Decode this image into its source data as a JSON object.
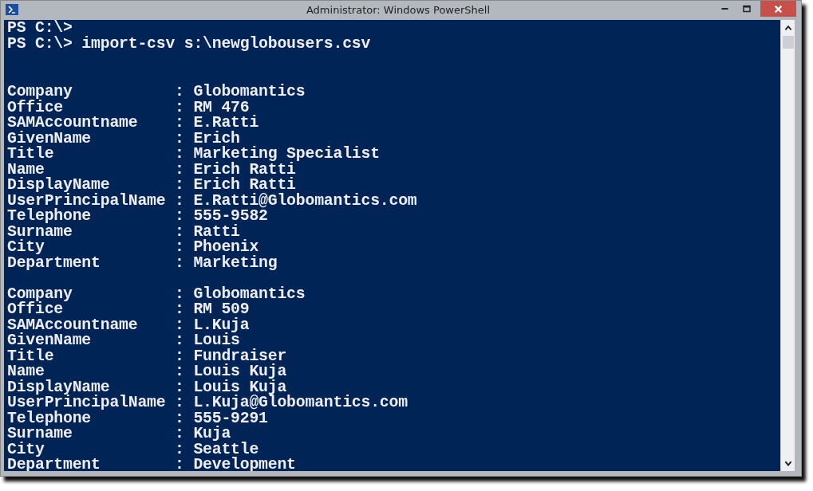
{
  "window": {
    "title": "Administrator: Windows PowerShell"
  },
  "console": {
    "command_lines": [
      "PS C:\\>",
      "PS C:\\> import-csv s:\\newglobousers.csv"
    ],
    "records": [
      {
        "lines": [
          "Company           : Globomantics",
          "Office            : RM 476",
          "SAMAccountname    : E.Ratti",
          "GivenName         : Erich",
          "Title             : Marketing Specialist",
          "Name              : Erich Ratti",
          "DisplayName       : Erich Ratti",
          "UserPrincipalName : E.Ratti@Globomantics.com",
          "Telephone         : 555-9582",
          "Surname           : Ratti",
          "City              : Phoenix",
          "Department        : Marketing"
        ]
      },
      {
        "lines": [
          "Company           : Globomantics",
          "Office            : RM 509",
          "SAMAccountname    : L.Kuja",
          "GivenName         : Louis",
          "Title             : Fundraiser",
          "Name              : Louis Kuja",
          "DisplayName       : Louis Kuja",
          "UserPrincipalName : L.Kuja@Globomantics.com",
          "Telephone         : 555-9291",
          "Surname           : Kuja",
          "City              : Seattle",
          "Department        : Development"
        ]
      }
    ]
  }
}
